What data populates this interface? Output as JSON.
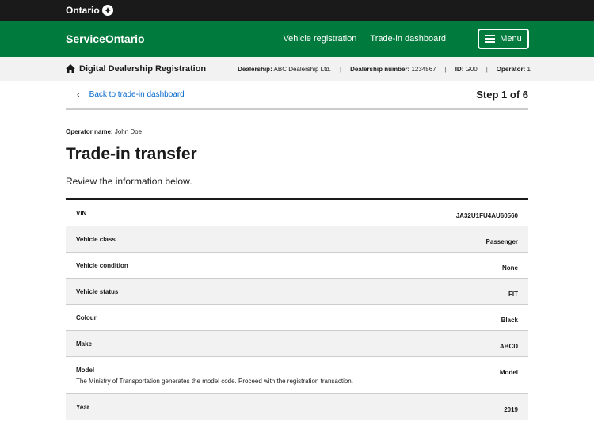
{
  "topbar": {
    "brand": "Ontario"
  },
  "header": {
    "title": "ServiceOntario",
    "nav": [
      "Vehicle registration",
      "Trade-in dashboard"
    ],
    "menu_label": "Menu"
  },
  "infobar": {
    "title": "Digital Dealership Registration",
    "dealership_label": "Dealership:",
    "dealership_value": "ABC Dealership Ltd.",
    "dealership_number_label": "Dealership number:",
    "dealership_number_value": "1234567",
    "id_label": "ID:",
    "id_value": "G00",
    "operator_label": "Operator:",
    "operator_value": "1"
  },
  "nav": {
    "back_label": "Back to trade-in dashboard",
    "step": "Step 1 of 6"
  },
  "operator": {
    "label": "Operator name:",
    "value": "John Doe"
  },
  "page": {
    "title": "Trade-in transfer",
    "lead": "Review the information below."
  },
  "rows": [
    {
      "label": "VIN",
      "value": "JA32U1FU4AU60560"
    },
    {
      "label": "Vehicle class",
      "value": "Passenger"
    },
    {
      "label": "Vehicle condition",
      "value": "None"
    },
    {
      "label": "Vehicle status",
      "value": "FIT"
    },
    {
      "label": "Colour",
      "value": "Black"
    },
    {
      "label": "Make",
      "value": "ABCD"
    },
    {
      "label": "Model",
      "value": "Model",
      "note": "The Ministry of Transportation generates the model code. Proceed with the registration transaction."
    },
    {
      "label": "Year",
      "value": "2019"
    }
  ]
}
